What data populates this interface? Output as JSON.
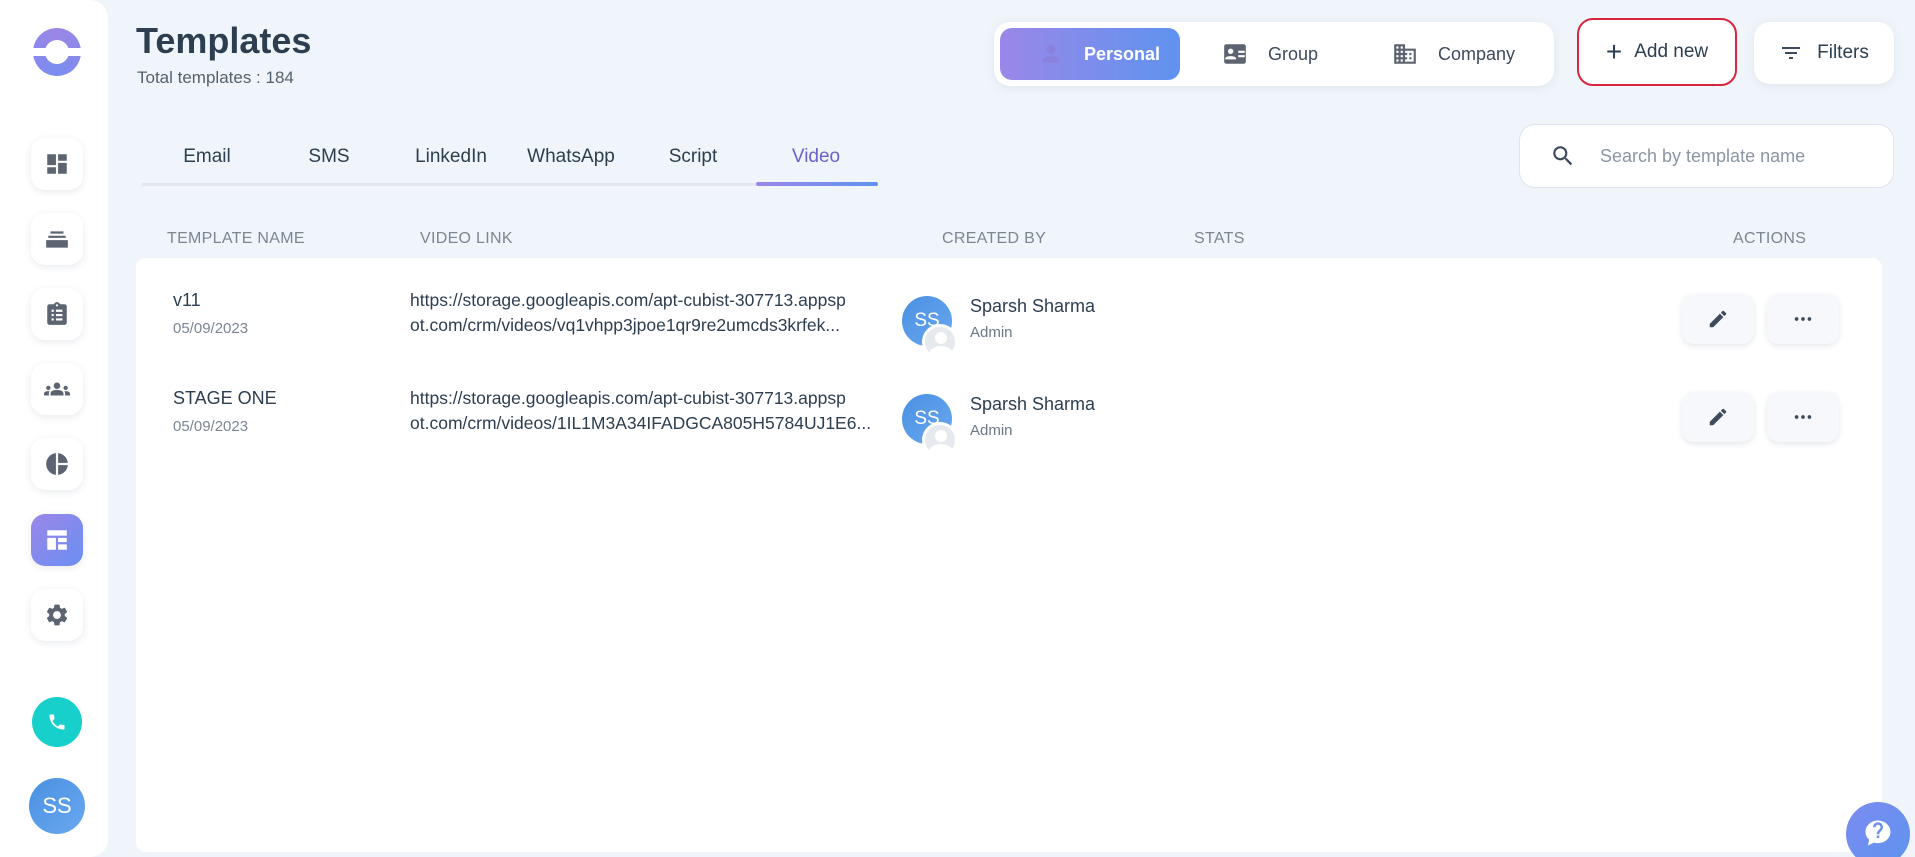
{
  "header": {
    "title": "Templates",
    "subtitle": "Total templates : 184"
  },
  "scope_switch": {
    "items": [
      {
        "label": "Personal",
        "icon": "person-icon",
        "active": true
      },
      {
        "label": "Group",
        "icon": "id-card-icon",
        "active": false
      },
      {
        "label": "Company",
        "icon": "building-icon",
        "active": false
      }
    ]
  },
  "toolbar": {
    "add_label": "Add new",
    "filter_label": "Filters"
  },
  "tabs": [
    {
      "label": "Email",
      "active": false
    },
    {
      "label": "SMS",
      "active": false
    },
    {
      "label": "LinkedIn",
      "active": false
    },
    {
      "label": "WhatsApp",
      "active": false
    },
    {
      "label": "Script",
      "active": false
    },
    {
      "label": "Video",
      "active": true
    }
  ],
  "search": {
    "placeholder": "Search by template name"
  },
  "table": {
    "columns": [
      "TEMPLATE NAME",
      "VIDEO LINK",
      "CREATED BY",
      "STATS",
      "ACTIONS"
    ],
    "rows": [
      {
        "name": "v11",
        "date": "05/09/2023",
        "link_line1": "https://storage.googleapis.com/apt-cubist-307713.appsp",
        "link_line2": "ot.com/crm/videos/vq1vhpp3jpoe1qr9re2umcds3krfek...",
        "creator_initials": "SS",
        "creator_name": "Sparsh Sharma",
        "creator_role": "Admin"
      },
      {
        "name": "STAGE ONE",
        "date": "05/09/2023",
        "link_line1": "https://storage.googleapis.com/apt-cubist-307713.appsp",
        "link_line2": "ot.com/crm/videos/1IL1M3A34IFADGCA805H5784UJ1E6...",
        "creator_initials": "SS",
        "creator_name": "Sparsh Sharma",
        "creator_role": "Admin"
      }
    ]
  },
  "sidebar": {
    "items": [
      {
        "icon": "dashboard-icon",
        "active": false
      },
      {
        "icon": "inbox-stack-icon",
        "active": false
      },
      {
        "icon": "clipboard-icon",
        "active": false
      },
      {
        "icon": "people-icon",
        "active": false
      },
      {
        "icon": "pie-chart-icon",
        "active": false
      },
      {
        "icon": "template-layout-icon",
        "active": true
      },
      {
        "icon": "gear-icon",
        "active": false
      }
    ],
    "user_initials": "SS"
  },
  "colors": {
    "accent_start": "#9a87e8",
    "accent_end": "#5f93ef",
    "add_border": "#d7263d",
    "phone": "#17d0cc"
  }
}
